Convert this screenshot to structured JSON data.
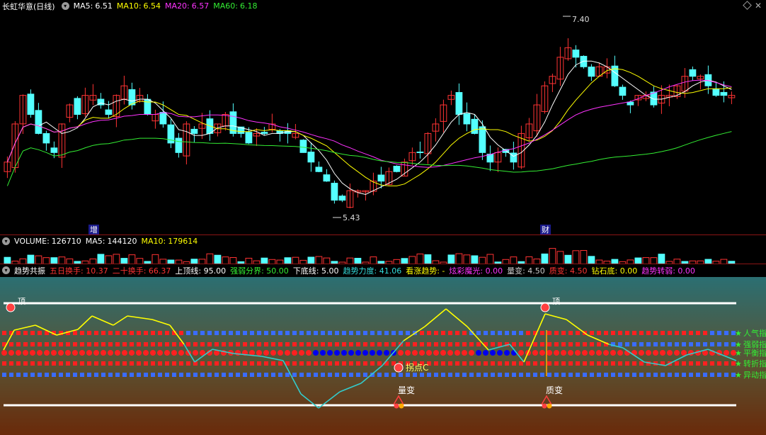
{
  "header": {
    "stock": "长虹华意(日线)",
    "items": [
      {
        "label": "MA5:",
        "value": "6.51",
        "color": "#ffffff"
      },
      {
        "label": "MA10:",
        "value": "6.54",
        "color": "#ffff00"
      },
      {
        "label": "MA20:",
        "value": "6.57",
        "color": "#ff33ff"
      },
      {
        "label": "MA60:",
        "value": "6.18",
        "color": "#33ee33"
      }
    ],
    "close_glyph": "✕"
  },
  "main_chart": {
    "high_label": "7.40",
    "low_label": "5.43",
    "markers": [
      "增",
      "财"
    ]
  },
  "volume_bar": {
    "items": [
      {
        "label": "VOLUME:",
        "value": "126710",
        "color": "#ffffff"
      },
      {
        "label": "MA5:",
        "value": "144120",
        "color": "#ffffff"
      },
      {
        "label": "MA10:",
        "value": "179614",
        "color": "#ffff00"
      }
    ]
  },
  "indicator_bar": {
    "title": "趋势共振",
    "items": [
      {
        "text": "五日换手: 10.37",
        "color": "#ff3333"
      },
      {
        "text": "二十换手: 66.37",
        "color": "#ff3333"
      },
      {
        "text": "上顶线: 95.00",
        "color": "#ffffff"
      },
      {
        "text": "强弱分界: 50.00",
        "color": "#33ee33"
      },
      {
        "text": "下底线: 5.00",
        "color": "#ffffff"
      },
      {
        "text": "趋势力度: 41.06",
        "color": "#33dddd"
      },
      {
        "text": "看涨趋势: -",
        "color": "#ffff00"
      },
      {
        "text": "炫彩魔光: 0.00",
        "color": "#ff33ff"
      },
      {
        "text": "量变: 4.50",
        "color": "#cccccc"
      },
      {
        "text": "质变: 4.50",
        "color": "#ff3333"
      },
      {
        "text": "钻石底: 0.00",
        "color": "#ffff00"
      },
      {
        "text": "趋势转弱: 0.00",
        "color": "#ff33ff"
      }
    ]
  },
  "indicator_chart": {
    "top_labels": [
      "顶",
      "顶"
    ],
    "inflection_label": "拐点C",
    "bottom_labels": [
      "量变",
      "质变"
    ],
    "row_labels": [
      "人气指",
      "强弱指",
      "平衡指",
      "转折指",
      "异动指"
    ]
  },
  "colors": {
    "up": "#ff3333",
    "down": "#54ffff",
    "ma5": "#ffffff",
    "ma10": "#ffff00",
    "ma20": "#ff33ff",
    "ma60": "#33ee33",
    "dotRed": "#ff2020",
    "dotBlue": "#3a6cff",
    "dotDarkBlue": "#0000ee"
  }
}
